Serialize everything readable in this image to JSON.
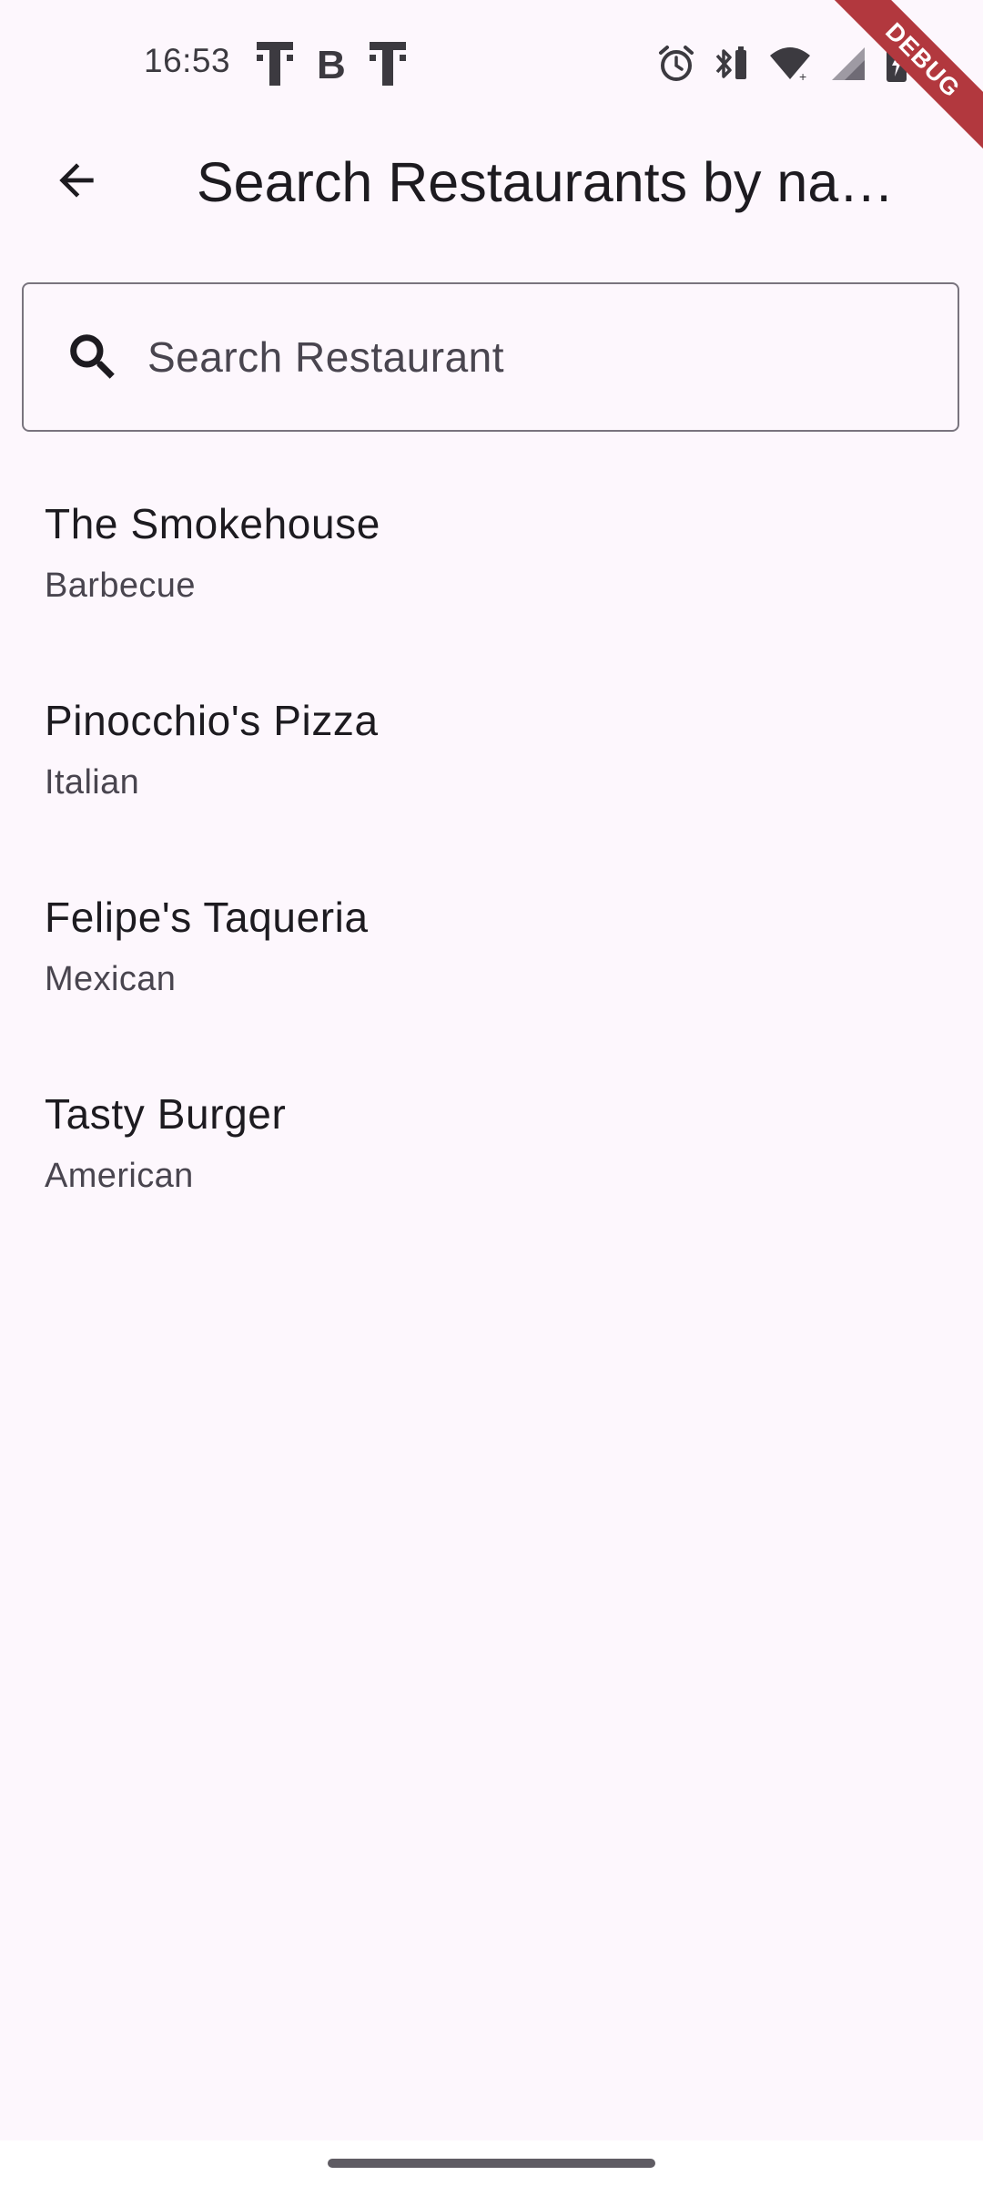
{
  "status_bar": {
    "time": "16:53",
    "left_icons": [
      "telekom-icon",
      "b-icon",
      "telekom-icon"
    ],
    "right_icons": [
      "alarm-icon",
      "bluetooth-battery-icon",
      "wifi-icon",
      "signal-icon",
      "battery-charging-icon"
    ]
  },
  "debug_banner": {
    "label": "DEBUG",
    "color": "#b2383e"
  },
  "app_bar": {
    "back_icon": "arrow-back-icon",
    "title": "Search Restaurants by na…"
  },
  "search": {
    "icon": "search-icon",
    "placeholder": "Search Restaurant",
    "value": ""
  },
  "restaurants": [
    {
      "name": "The Smokehouse",
      "cuisine": "Barbecue"
    },
    {
      "name": "Pinocchio's Pizza",
      "cuisine": "Italian"
    },
    {
      "name": "Felipe's Taqueria",
      "cuisine": "Mexican"
    },
    {
      "name": "Tasty Burger",
      "cuisine": "American"
    }
  ],
  "colors": {
    "background": "#fdf7fd",
    "text_primary": "#1d1b20",
    "text_secondary": "#49454f",
    "outline": "#79747e"
  }
}
